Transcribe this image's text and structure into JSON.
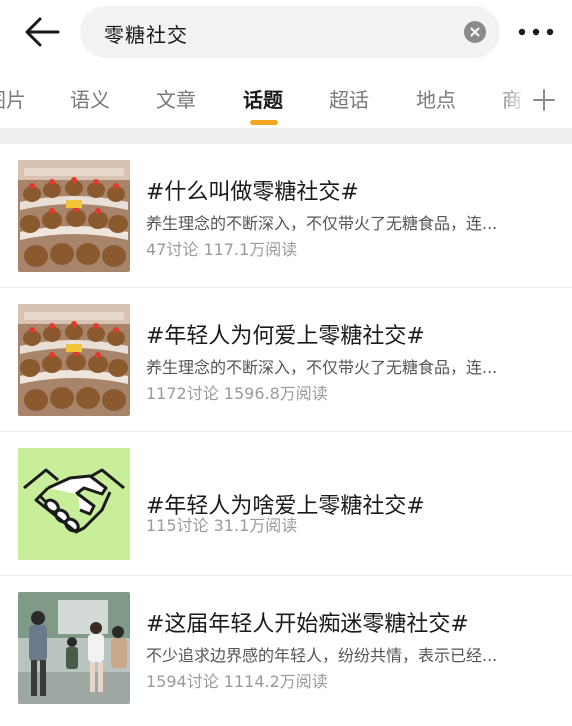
{
  "search": {
    "query": "零糖社交"
  },
  "tabs": [
    {
      "label": "图片",
      "active": false
    },
    {
      "label": "语义",
      "active": false
    },
    {
      "label": "文章",
      "active": false
    },
    {
      "label": "话题",
      "active": true
    },
    {
      "label": "超话",
      "active": false
    },
    {
      "label": "地点",
      "active": false
    },
    {
      "label": "商",
      "active": false
    }
  ],
  "colors": {
    "accent": "#f5a623",
    "divider": "#eeeeee"
  },
  "topics": [
    {
      "title": "#什么叫做零糖社交#",
      "desc": "养生理念的不断深入，不仅带火了无糖食品，连...",
      "stats": "47讨论 117.1万阅读",
      "thumb": "plush-display-photo"
    },
    {
      "title": "#年轻人为何爱上零糖社交#",
      "desc": "养生理念的不断深入，不仅带火了无糖食品，连...",
      "stats": "1172讨论 1596.8万阅读",
      "thumb": "plush-display-photo"
    },
    {
      "title": "#年轻人为啥爱上零糖社交#",
      "desc": "",
      "stats": "115讨论 31.1万阅读",
      "thumb": "handshake-illustration"
    },
    {
      "title": "#这届年轻人开始痴迷零糖社交#",
      "desc": "不少追求边界感的年轻人，纷纷共情，表示已经...",
      "stats": "1594讨论 1114.2万阅读",
      "thumb": "street-people-photo"
    }
  ]
}
